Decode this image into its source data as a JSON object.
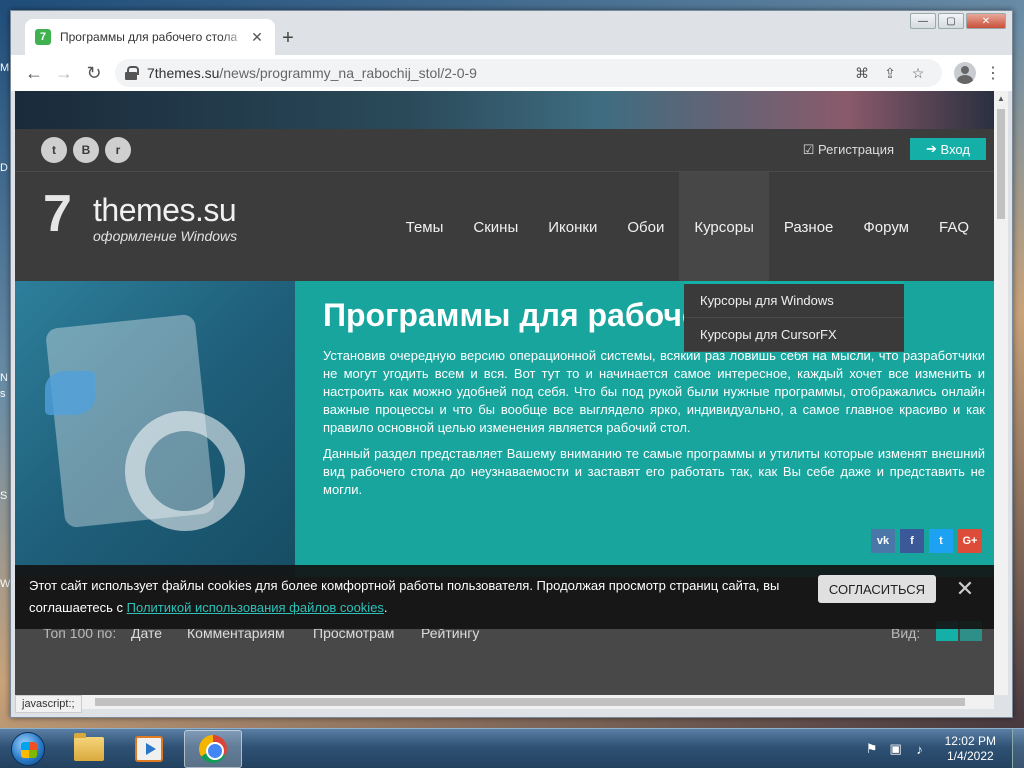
{
  "desktop": {
    "fragments": [
      "M",
      "D",
      "N",
      "s",
      "S",
      "W"
    ]
  },
  "browser": {
    "tab_title": "Программы для рабочего стола",
    "tab_close": "✕",
    "new_tab": "+",
    "win_controls": {
      "minimize": "—",
      "maximize": "▢",
      "close": "✕"
    },
    "nav": {
      "back": "←",
      "forward": "→",
      "reload": "↻"
    },
    "url_host": "7themes.su",
    "url_path": "/news/programmy_na_rabochij_stol/2-0-9",
    "icons": [
      "translate-icon",
      "share-icon",
      "star-icon",
      "profile-icon",
      "menu-icon"
    ],
    "status_text": "javascript:;"
  },
  "site": {
    "social": [
      "t",
      "B",
      "r"
    ],
    "register": "Регистрация",
    "login": "Вход",
    "logo_name": "themes.su",
    "logo_sub": "оформление Windows",
    "menu": [
      "Темы",
      "Скины",
      "Иконки",
      "Обои",
      "Курсоры",
      "Разное",
      "Форум",
      "FAQ"
    ],
    "active_menu": "Курсоры",
    "dropdown": [
      "Курсоры для Windows",
      "Курсоры для CursorFX"
    ],
    "hero_title": "Программы для рабоче",
    "hero_p1": "Установив очередную версию операционной системы, всякий раз ловишь себя на мысли, что разработчики не могут угодить всем и вся. Вот тут то и начинается самое интересное, каждый хочет все изменить и настроить как можно удобней под себя. Что бы под рукой были нужные программы, отображались онлайн важные процессы и что бы вообще все выглядело ярко, индивидуально, а самое главное красиво и как правило основной целью изменения является рабочий стол.",
    "hero_p2": "Данный раздел представляет Вашему вниманию те самые программы и утилиты которые изменят внешний вид рабочего стола до неузнаваемости и заставят его работать так, как Вы себе даже и представить не могли.",
    "share": [
      {
        "label": "vk",
        "color": "#4a76a8"
      },
      {
        "label": "f",
        "color": "#3b5998"
      },
      {
        "label": "t",
        "color": "#1da1f2"
      },
      {
        "label": "G+",
        "color": "#dd4b39"
      }
    ],
    "sort_label": "Топ 100 по:",
    "sort_options": [
      "Дате",
      "Комментариям",
      "Просмотрам",
      "Рейтингу"
    ],
    "view_label": "Вид:"
  },
  "cookie": {
    "text": "Этот сайт использует файлы cookies для более комфортной работы пользователя. Продолжая просмотр страниц сайта, вы соглашаетесь с",
    "link": "Политикой использования файлов cookies",
    "tail": ".",
    "accept": "СОГЛАСИТЬСЯ",
    "close": "✕"
  },
  "taskbar": {
    "apps": [
      "explorer",
      "media-player",
      "chrome"
    ],
    "time": "12:02 PM",
    "date": "1/4/2022"
  },
  "colors": {
    "accent": "#14b0a8",
    "hero": "#17a59d",
    "site_dark": "#3c3c3c"
  }
}
